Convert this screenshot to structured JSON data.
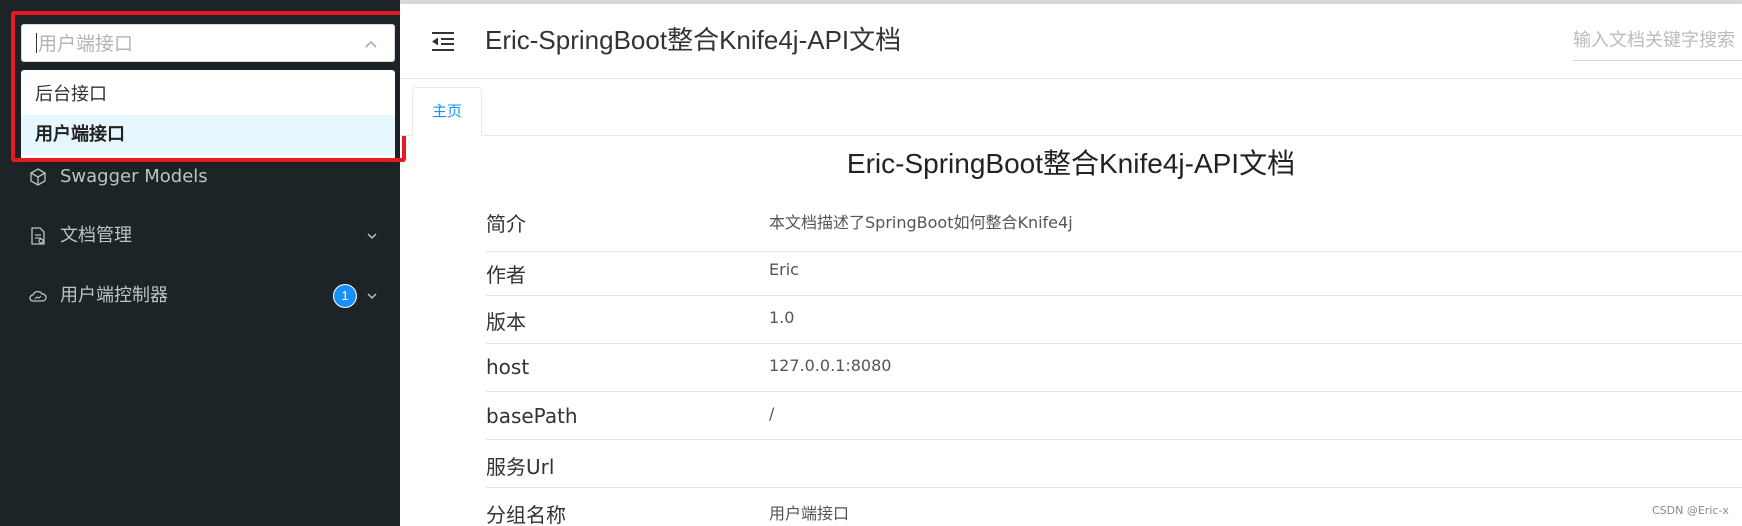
{
  "sidebar": {
    "group_select": {
      "placeholder": "用户端接口",
      "options": [
        {
          "label": "后台接口",
          "selected": false
        },
        {
          "label": "用户端接口",
          "selected": true
        }
      ]
    },
    "menu": [
      {
        "label": "Swagger Models",
        "icon": "cube-icon"
      },
      {
        "label": "文档管理",
        "icon": "document-icon",
        "expandable": true
      },
      {
        "label": "用户端控制器",
        "icon": "cloud-icon",
        "expandable": true,
        "badge": "1"
      }
    ]
  },
  "header": {
    "title": "Eric-SpringBoot整合Knife4j-API文档",
    "search_placeholder": "输入文档关键字搜索"
  },
  "tabs": [
    {
      "label": "主页",
      "active": true
    }
  ],
  "doc": {
    "title": "Eric-SpringBoot整合Knife4j-API文档",
    "rows": [
      {
        "key": "简介",
        "value": "本文档描述了SpringBoot如何整合Knife4j"
      },
      {
        "key": "作者",
        "value": "Eric"
      },
      {
        "key": "版本",
        "value": "1.0"
      },
      {
        "key": "host",
        "value": "127.0.0.1:8080"
      },
      {
        "key": "basePath",
        "value": "/"
      },
      {
        "key": "服务Url",
        "value": ""
      },
      {
        "key": "分组名称",
        "value": "用户端接口"
      }
    ]
  },
  "watermark": "CSDN @Eric-x",
  "colors": {
    "sidebar_bg": "#1d2428",
    "accent": "#1890ff",
    "highlight": "#e5191f"
  }
}
